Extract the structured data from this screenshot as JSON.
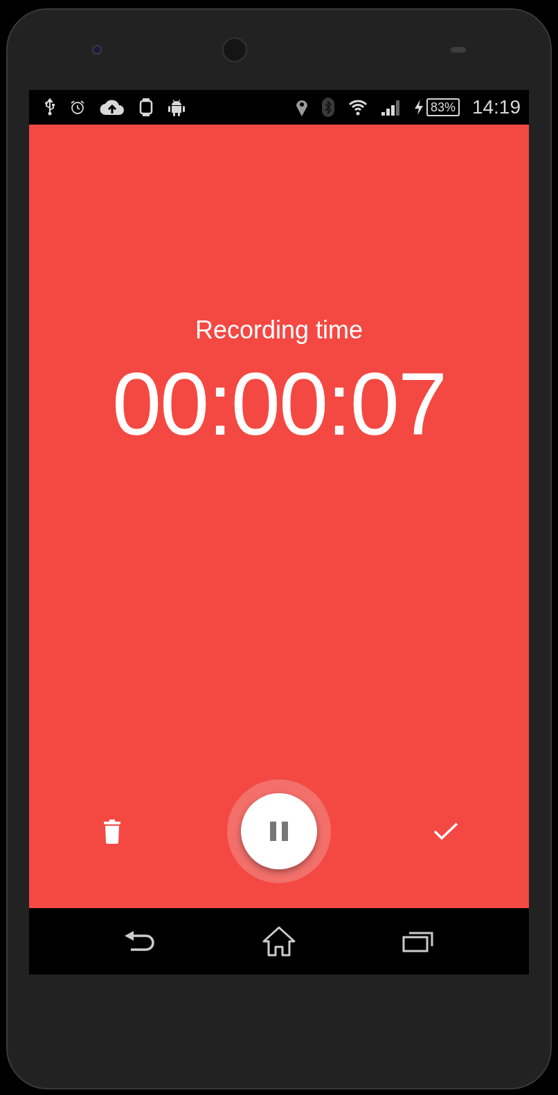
{
  "status_bar": {
    "battery": "83%",
    "time": "14:19"
  },
  "screen": {
    "title": "Recording time",
    "elapsed": "00:00:07"
  },
  "controls": {
    "recording": true
  }
}
